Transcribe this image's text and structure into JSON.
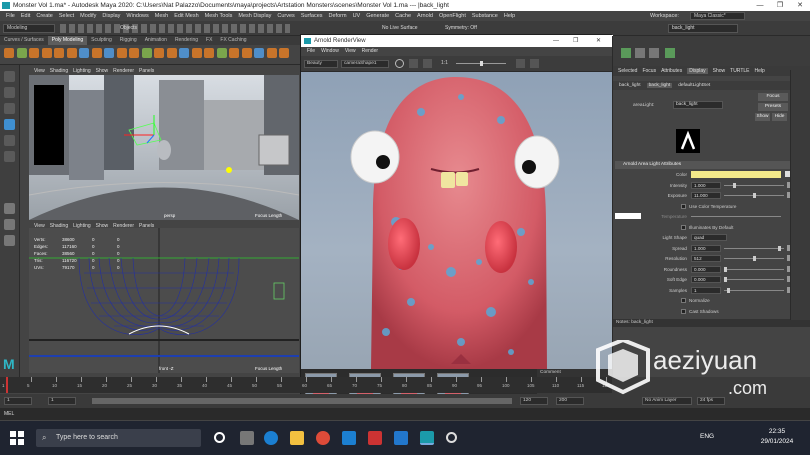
{
  "window": {
    "title": "Monster Vol 1.ma* - Autodesk Maya 2020: C:\\Users\\Nat Palazzo\\Documents\\maya\\projects\\Artstation Monsters\\scenes\\Monster Vol 1.ma  ---  |back_light",
    "minimize": "—",
    "maximize": "❐",
    "close": "✕"
  },
  "menubar": {
    "items": [
      "File",
      "Edit",
      "Create",
      "Select",
      "Modify",
      "Display",
      "Windows",
      "Mesh",
      "Edit Mesh",
      "Mesh Tools",
      "Mesh Display",
      "Curves",
      "Surfaces",
      "Deform",
      "UV",
      "Generate",
      "Cache",
      "Arnold",
      "OpenFlight",
      "Substance",
      "Help"
    ],
    "workspace_label": "Workspace:",
    "workspace_value": "Maya Classic*"
  },
  "statusline": {
    "mode": "Modeling",
    "objects_label": "Objects",
    "live_surface": "No Live Surface",
    "symmetry": "Symmetry: Off",
    "name_field": "back_light"
  },
  "shelf": {
    "tabs": [
      "Curves / Surfaces",
      "Poly Modeling",
      "Sculpting",
      "Rigging",
      "Animation",
      "Rendering",
      "FX",
      "FX Caching"
    ],
    "active_tab": "Poly Modeling"
  },
  "viewport_top": {
    "menu": [
      "View",
      "Shading",
      "Lighting",
      "Show",
      "Renderer",
      "Panels"
    ],
    "camera_label": "persp",
    "focal_label": "Focus Length"
  },
  "viewport_bottom": {
    "menu": [
      "View",
      "Shading",
      "Lighting",
      "Show",
      "Renderer",
      "Panels"
    ],
    "hud": [
      {
        "label": "Verts:",
        "a": "38600",
        "b": "0",
        "c": "0"
      },
      {
        "label": "Edges:",
        "a": "117160",
        "b": "0",
        "c": "0"
      },
      {
        "label": "Faces:",
        "a": "38560",
        "b": "0",
        "c": "0"
      },
      {
        "label": "Tris:",
        "a": "116720",
        "b": "0",
        "c": "0"
      },
      {
        "label": "UVs:",
        "a": "79170",
        "b": "0",
        "c": "0"
      }
    ],
    "camera_label": "front -Z",
    "focal_label": "Focus Length"
  },
  "render_view": {
    "title": "Arnold RenderView",
    "menu": [
      "File",
      "Window",
      "View",
      "Render"
    ],
    "display_mode": "Beauty",
    "camera": "cameraShape1",
    "ratio": "1:1",
    "status": "00:06:22 | 800x600 (1:1) | cameraShape1 | samples 2/1/1/1/1/1/1 | 6672.84 MB",
    "content_label": "Comment",
    "thumb_count": 4
  },
  "attribute_editor": {
    "tabs": [
      "Selected",
      "Focus",
      "Attributes",
      "Display",
      "Show",
      "TURTLE",
      "Help"
    ],
    "active_tab": "Display",
    "node_tabs": [
      "back_light",
      "back_light",
      "defaultLightSet"
    ],
    "active_node_tab": "back_light",
    "transform_label": "areaLight:",
    "transform_value": "back_light",
    "focus_button": "Focus",
    "presets_button": "Presets",
    "show_button": "Show",
    "hide_button": "Hide",
    "section_title": "Arnold Area Light Attributes",
    "rows": [
      {
        "label": "Color",
        "value": "",
        "type": "color"
      },
      {
        "label": "Intensity",
        "value": "1.000",
        "fraction": 0.15
      },
      {
        "label": "Exposure",
        "value": "11.000",
        "fraction": 0.5
      },
      {
        "label": "Use Color Temperature",
        "value": "",
        "type": "check"
      },
      {
        "label": "Temperature",
        "value": "",
        "type": "temp"
      },
      {
        "label": "Illuminates By Default",
        "value": "",
        "type": "check"
      },
      {
        "label": "Light Shape",
        "value": "quad",
        "type": "select"
      },
      {
        "label": "Spread",
        "value": "1.000",
        "fraction": 0.95
      },
      {
        "label": "Resolution",
        "value": "512",
        "fraction": 0.5
      },
      {
        "label": "Roundness",
        "value": "0.000",
        "fraction": 0.0
      },
      {
        "label": "Soft Edge",
        "value": "0.000",
        "fraction": 0.0
      },
      {
        "label": "Samples",
        "value": "1",
        "fraction": 0.05
      },
      {
        "label": "Normalize",
        "value": "",
        "type": "check"
      },
      {
        "label": "Cast Shadows",
        "value": "",
        "type": "check"
      }
    ],
    "notes_label": "Notes: back_light",
    "color_swatch": "#f3e98a"
  },
  "timeline": {
    "ticks": [
      "1",
      "5",
      "10",
      "15",
      "20",
      "25",
      "30",
      "35",
      "40",
      "45",
      "50",
      "55",
      "60",
      "65",
      "70",
      "75",
      "80",
      "85",
      "90",
      "95",
      "100",
      "105",
      "110",
      "115",
      "120"
    ],
    "start": "1",
    "end": "120",
    "range_end": "200",
    "anim_layer": "No Anim Layer",
    "fps": "24 fps"
  },
  "command_line": {
    "label": "MEL"
  },
  "taskbar": {
    "search_placeholder": "Type here to search",
    "language": "ENG",
    "time": "22:35",
    "date": "29/01/2024"
  },
  "watermark": {
    "brand": "aeziyuan",
    "domain": ".com"
  }
}
